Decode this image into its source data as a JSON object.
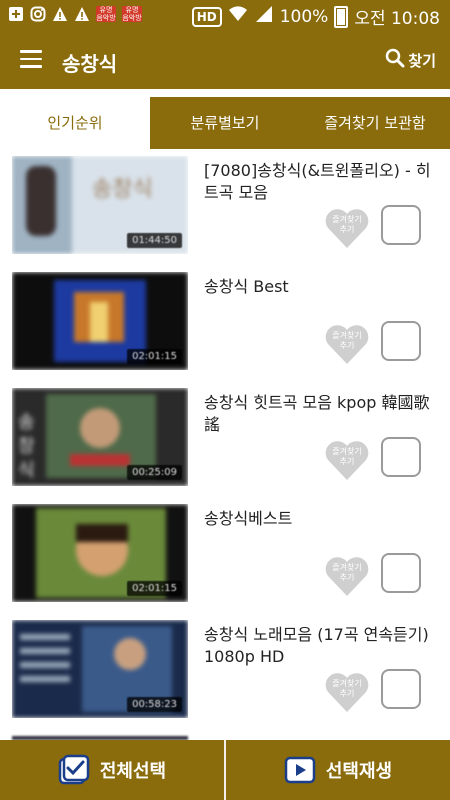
{
  "status_bar": {
    "notif_badges": [
      "유명 음악방",
      "유명 음악방"
    ],
    "hd": "HD",
    "battery": "100%",
    "time": "오전 10:08"
  },
  "app_bar": {
    "title": "송창식",
    "search_label": "찾기"
  },
  "tabs": [
    {
      "label": "인기순위",
      "active": true
    },
    {
      "label": "분류별보기",
      "active": false
    },
    {
      "label": "즐겨찾기 보관함",
      "active": false
    }
  ],
  "videos": [
    {
      "title": "[7080]송창식(&트윈폴리오) - 히트곡 모음",
      "duration": "01:44:50",
      "fav_label": "즐겨찾기\n추기"
    },
    {
      "title": "송창식 Best",
      "duration": "02:01:15",
      "fav_label": "즐겨찾기\n추기"
    },
    {
      "title": "송창식 힛트곡 모음 kpop 韓國歌謠",
      "duration": "00:25:09",
      "fav_label": "즐겨찾기\n추기"
    },
    {
      "title": "송창식베스트",
      "duration": "02:01:15",
      "fav_label": "즐겨찾기\n추기"
    },
    {
      "title": "송창식 노래모음 (17곡 연속듣기) 1080p HD",
      "duration": "00:58:23",
      "fav_label": "즐겨찾기\n추기"
    }
  ],
  "bottom_bar": {
    "select_all": "전체선택",
    "play_selected": "선택재생"
  },
  "colors": {
    "brand": "#8a6c0c",
    "heart": "#cfcfcf"
  }
}
